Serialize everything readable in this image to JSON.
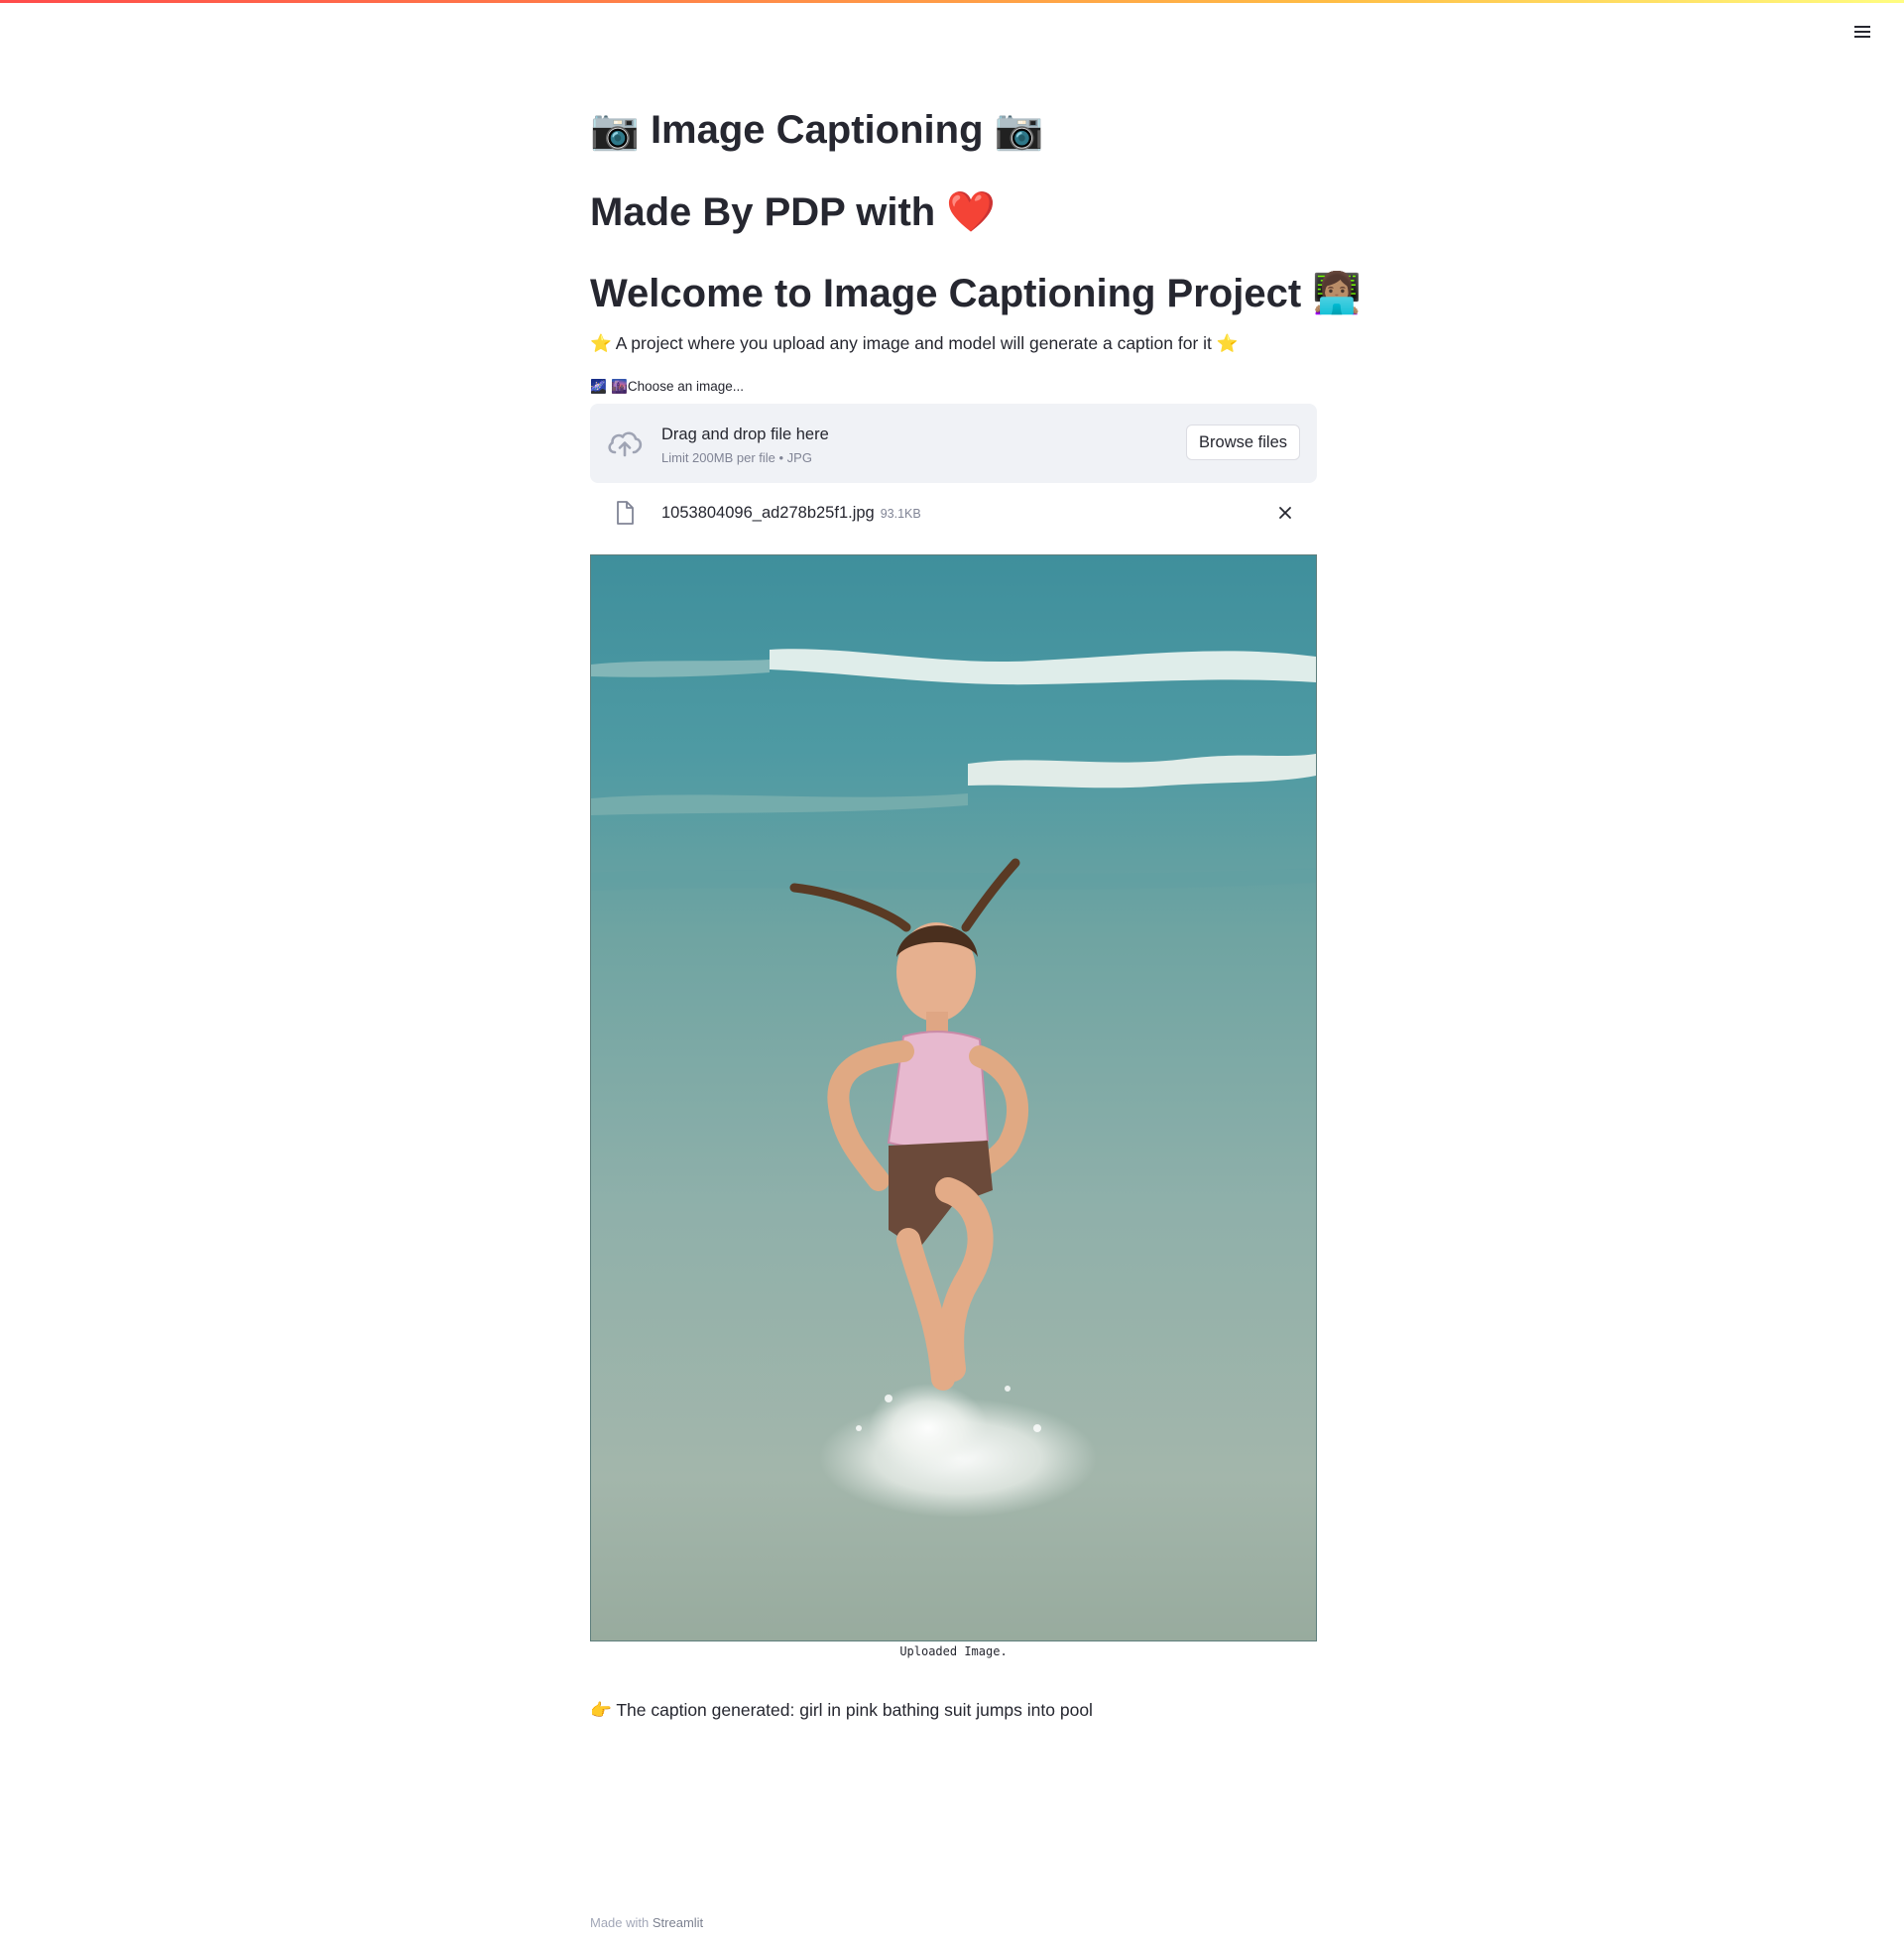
{
  "header": {
    "menu_icon": "hamburger-menu-icon",
    "decoration_colors": [
      "#ff4b4b",
      "#ffbd45",
      "#fffd80"
    ]
  },
  "title": {
    "prefix_emoji": "📷",
    "text": "Image Captioning",
    "suffix_emoji": "📷"
  },
  "byline": {
    "text": "Made By PDP with",
    "emoji": "❤️"
  },
  "welcome": {
    "text": "Welcome to Image Captioning Project",
    "emoji": "👩🏽‍💻"
  },
  "description": {
    "prefix_emoji": "⭐",
    "text": "A project where you upload any image and model will generate a caption for it",
    "suffix_emoji": "⭐"
  },
  "uploader": {
    "label_emojis": "🌌 🌆",
    "label": "Choose an image...",
    "drop_text": "Drag and drop file here",
    "limit_text": "Limit 200MB per file • JPG",
    "browse_label": "Browse files",
    "upload_icon": "cloud-upload-icon"
  },
  "uploaded_file": {
    "name": "1053804096_ad278b25f1.jpg",
    "size": "93.1KB",
    "file_icon": "file-icon",
    "remove_icon": "close-icon"
  },
  "image": {
    "caption": "Uploaded Image."
  },
  "result": {
    "emoji": "👉",
    "label": "The caption generated:",
    "caption": "girl in pink bathing suit jumps into pool"
  },
  "footer": {
    "prefix": "Made with",
    "link": "Streamlit"
  }
}
